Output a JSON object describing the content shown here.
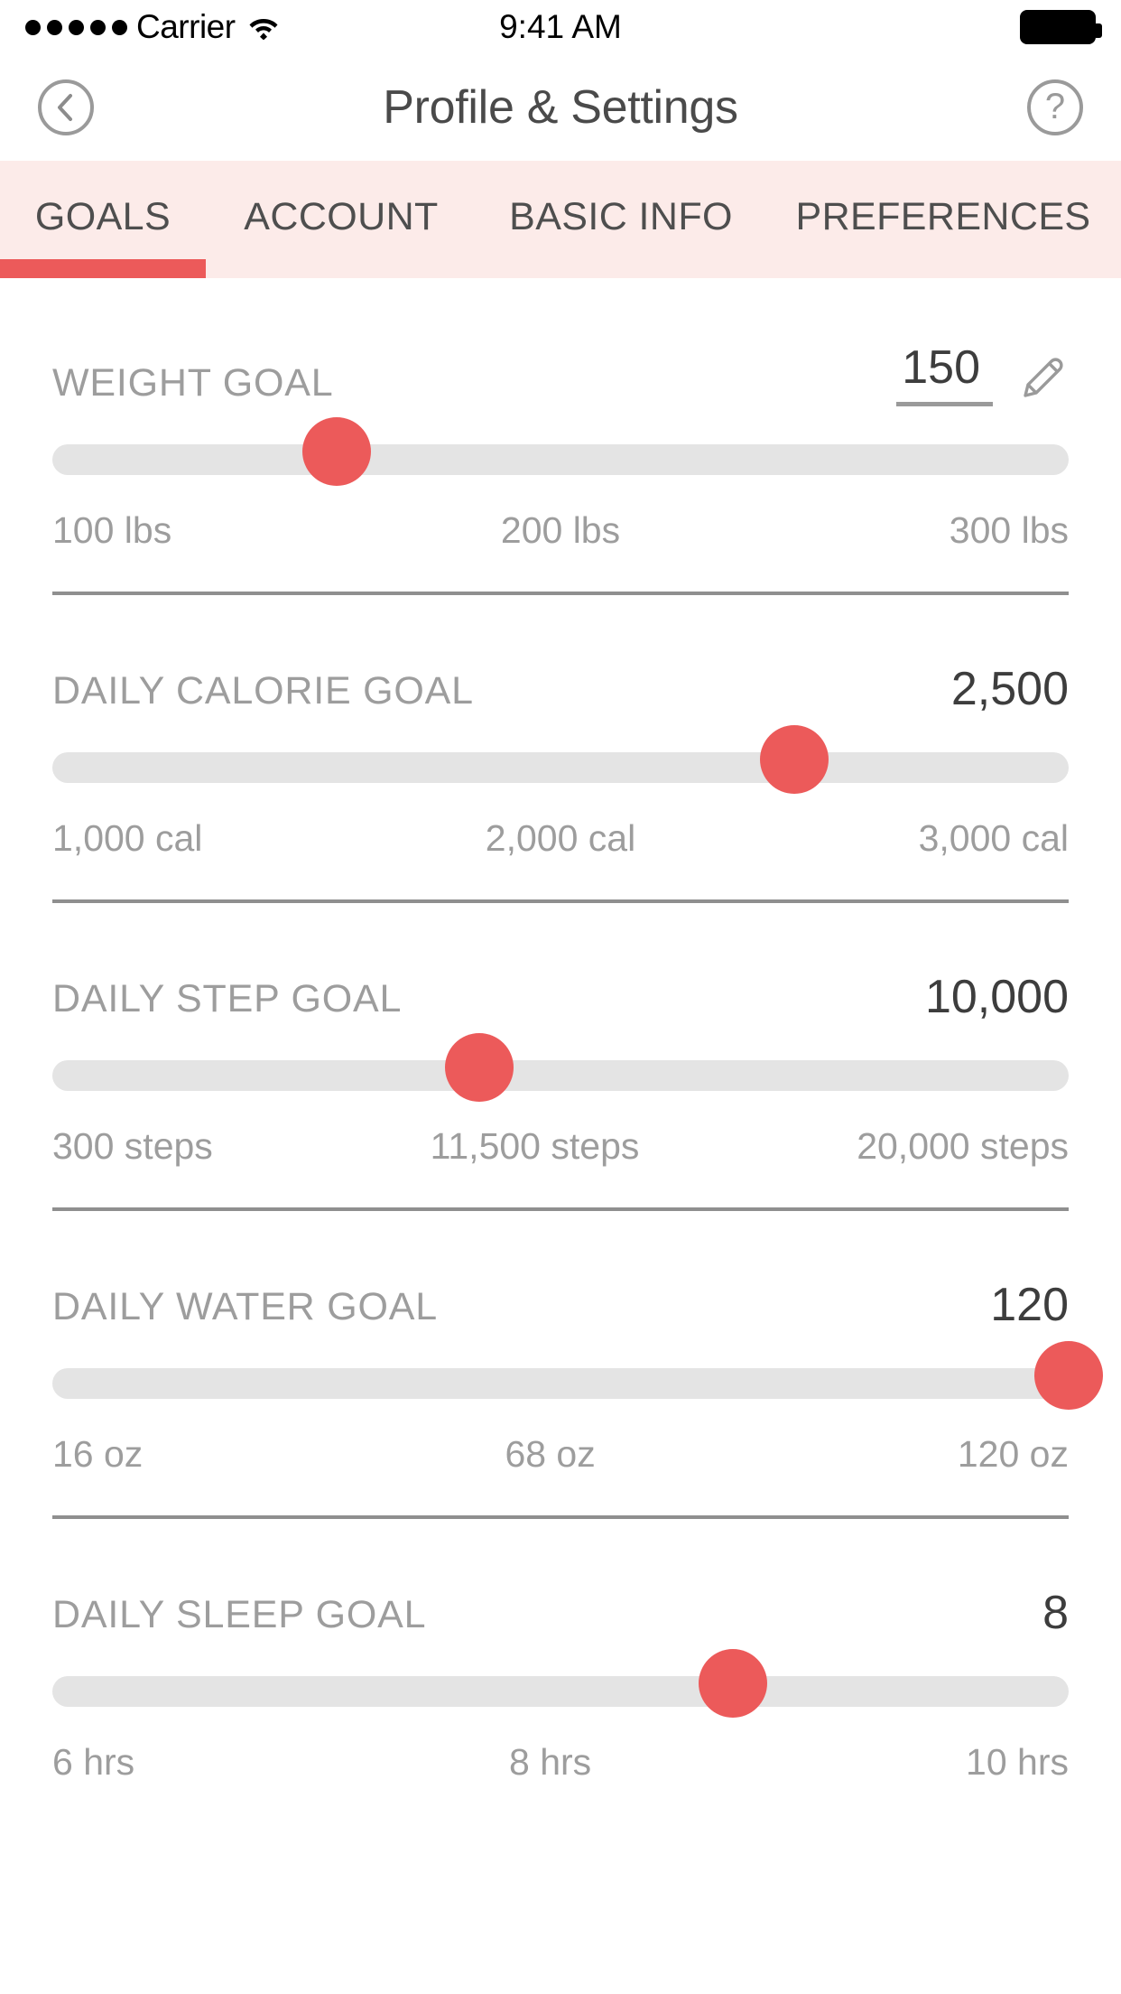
{
  "status_bar": {
    "signal_dots": 5,
    "carrier": "Carrier",
    "wifi_icon": "wifi-icon",
    "time": "9:41 AM",
    "battery_icon": "battery-full-icon"
  },
  "nav_bar": {
    "back_icon": "chevron-left-icon",
    "title": "Profile & Settings",
    "help_icon": "question-mark-icon",
    "help_label": "?"
  },
  "tabs": {
    "active_index": 0,
    "items": [
      {
        "label": "GOALS"
      },
      {
        "label": "ACCOUNT"
      },
      {
        "label": "BASIC INFO"
      },
      {
        "label": "PREFERENCES"
      }
    ]
  },
  "colors": {
    "accent": "#ec5a5a",
    "tab_background": "#fcebe9",
    "track": "#e4e4e4",
    "label_text": "#9d9d9d",
    "value_text": "#3d3d3d",
    "divider": "#8f8f8f"
  },
  "goals": [
    {
      "label": "WEIGHT GOAL",
      "value": "150",
      "editable": true,
      "edit_icon": "pencil-icon",
      "thumb_percent": 28,
      "scale": [
        "100 lbs",
        "200 lbs",
        "300 lbs"
      ]
    },
    {
      "label": "DAILY CALORIE GOAL",
      "value": "2,500",
      "editable": false,
      "thumb_percent": 73,
      "scale": [
        "1,000 cal",
        "2,000 cal",
        "3,000 cal"
      ]
    },
    {
      "label": "DAILY STEP GOAL",
      "value": "10,000",
      "editable": false,
      "thumb_percent": 42,
      "scale": [
        "300 steps",
        "11,500 steps",
        "20,000 steps"
      ]
    },
    {
      "label": "DAILY WATER GOAL",
      "value": "120",
      "editable": false,
      "thumb_percent": 100,
      "scale": [
        "16 oz",
        "68 oz",
        "120 oz"
      ]
    },
    {
      "label": "DAILY SLEEP GOAL",
      "value": "8",
      "editable": false,
      "thumb_percent": 67,
      "scale": [
        "6 hrs",
        "8 hrs",
        "10 hrs"
      ]
    }
  ]
}
